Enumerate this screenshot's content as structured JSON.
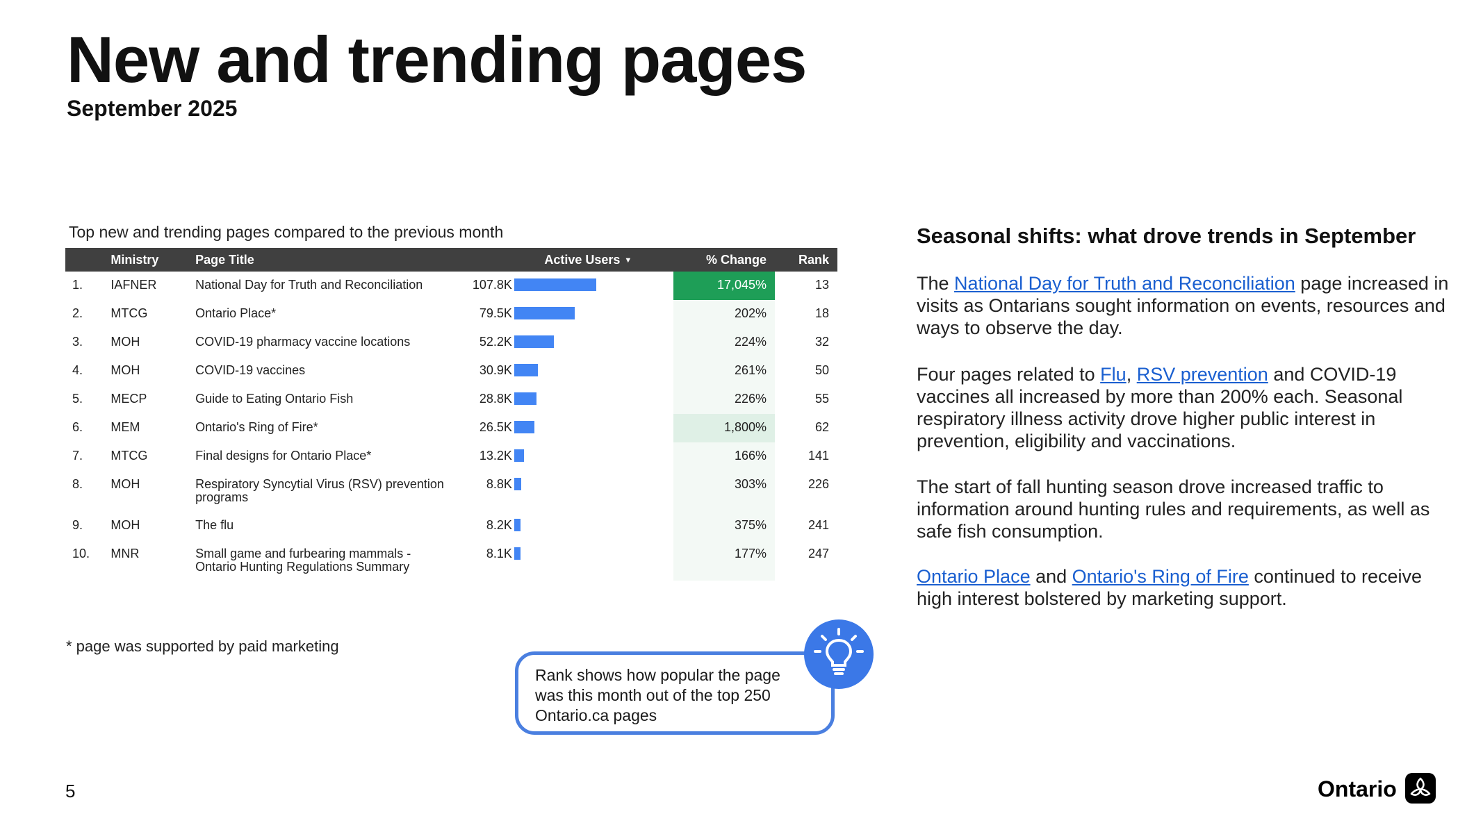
{
  "header": {
    "title": "New and trending pages",
    "subtitle": "September 2025"
  },
  "table": {
    "caption": "Top new and trending pages compared to the previous month",
    "columns": {
      "index": "",
      "ministry": "Ministry",
      "page_title": "Page Title",
      "active_users": "Active Users",
      "change": "% Change",
      "rank": "Rank"
    },
    "sort_caret": "▼",
    "rows": [
      {
        "index": "1.",
        "ministry": "IAFNER",
        "page_title": "National Day for Truth and Reconciliation",
        "active_users": "107.8K",
        "users_value": 107.8,
        "change": "17,045%",
        "rank": "13"
      },
      {
        "index": "2.",
        "ministry": "MTCG",
        "page_title": "Ontario Place*",
        "active_users": "79.5K",
        "users_value": 79.5,
        "change": "202%",
        "rank": "18"
      },
      {
        "index": "3.",
        "ministry": "MOH",
        "page_title": "COVID-19 pharmacy vaccine locations",
        "active_users": "52.2K",
        "users_value": 52.2,
        "change": "224%",
        "rank": "32"
      },
      {
        "index": "4.",
        "ministry": "MOH",
        "page_title": "COVID-19 vaccines",
        "active_users": "30.9K",
        "users_value": 30.9,
        "change": "261%",
        "rank": "50"
      },
      {
        "index": "5.",
        "ministry": "MECP",
        "page_title": "Guide to Eating Ontario Fish",
        "active_users": "28.8K",
        "users_value": 28.8,
        "change": "226%",
        "rank": "55"
      },
      {
        "index": "6.",
        "ministry": "MEM",
        "page_title": "Ontario's Ring of Fire*",
        "active_users": "26.5K",
        "users_value": 26.5,
        "change": "1,800%",
        "rank": "62"
      },
      {
        "index": "7.",
        "ministry": "MTCG",
        "page_title": "Final designs for Ontario Place*",
        "active_users": "13.2K",
        "users_value": 13.2,
        "change": "166%",
        "rank": "141"
      },
      {
        "index": "8.",
        "ministry": "MOH",
        "page_title": "Respiratory Syncytial Virus (RSV) prevention programs",
        "active_users": "8.8K",
        "users_value": 8.8,
        "change": "303%",
        "rank": "226"
      },
      {
        "index": "9.",
        "ministry": "MOH",
        "page_title": "The flu",
        "active_users": "8.2K",
        "users_value": 8.2,
        "change": "375%",
        "rank": "241"
      },
      {
        "index": "10.",
        "ministry": "MNR",
        "page_title": "Small game and furbearing mammals - Ontario Hunting Regulations Summary",
        "active_users": "8.1K",
        "users_value": 8.1,
        "change": "177%",
        "rank": "247"
      }
    ],
    "bar_color": "#4285f4",
    "change_high_color": "#1e9e57"
  },
  "footnote": "* page was supported by paid marketing",
  "callout": {
    "text": "Rank shows how popular the page was this month out of the top 250 Ontario.ca pages",
    "icon": "lightbulb-icon"
  },
  "sidebar": {
    "title": "Seasonal shifts: what drove trends in September",
    "p1": {
      "pre": "The ",
      "link": "National Day for Truth and Reconciliation",
      "post": " page increased in visits as Ontarians sought information on events, resources and ways to observe the day."
    },
    "p2": {
      "pre": "Four pages related to ",
      "link1": "Flu",
      "sep": ", ",
      "link2": "RSV prevention",
      "post": " and COVID-19 vaccines all increased by more than 200% each. Seasonal respiratory illness activity drove higher public interest in prevention, eligibility and vaccinations."
    },
    "p3": {
      "text": "The start of fall hunting season drove increased traffic to information around hunting rules and requirements, as well as safe fish consumption."
    },
    "p4": {
      "link1": "Ontario Place",
      "mid": " and ",
      "link2": "Ontario's Ring of Fire",
      "post": " continued to receive high interest bolstered by marketing support."
    }
  },
  "footer": {
    "page_number": "5",
    "brand": "Ontario",
    "logo_icon": "trillium-logo-icon"
  }
}
